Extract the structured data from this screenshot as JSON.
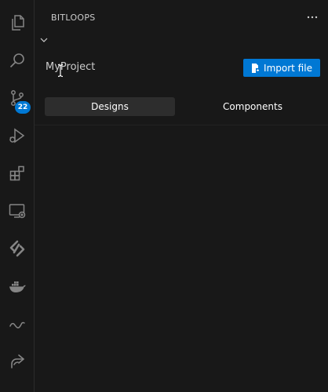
{
  "activity_bar": {
    "items": [
      {
        "icon": "files-icon"
      },
      {
        "icon": "search-icon"
      },
      {
        "icon": "source-control-icon",
        "badge": "22"
      },
      {
        "icon": "run-debug-icon"
      },
      {
        "icon": "extensions-icon"
      },
      {
        "icon": "remote-explorer-icon"
      },
      {
        "icon": "bitloops-icon"
      },
      {
        "icon": "docker-icon"
      },
      {
        "icon": "infinity-icon"
      },
      {
        "icon": "share-icon"
      }
    ]
  },
  "panel": {
    "title": "BITLOOPS",
    "more_actions": "···"
  },
  "project": {
    "name": "MyProject",
    "import_button_label": "Import file"
  },
  "tabs": [
    {
      "label": "Designs",
      "active": true
    },
    {
      "label": "Components",
      "active": false
    }
  ],
  "colors": {
    "background": "#181818",
    "accent": "#0078d4",
    "icon": "#858585",
    "text": "#cccccc"
  }
}
